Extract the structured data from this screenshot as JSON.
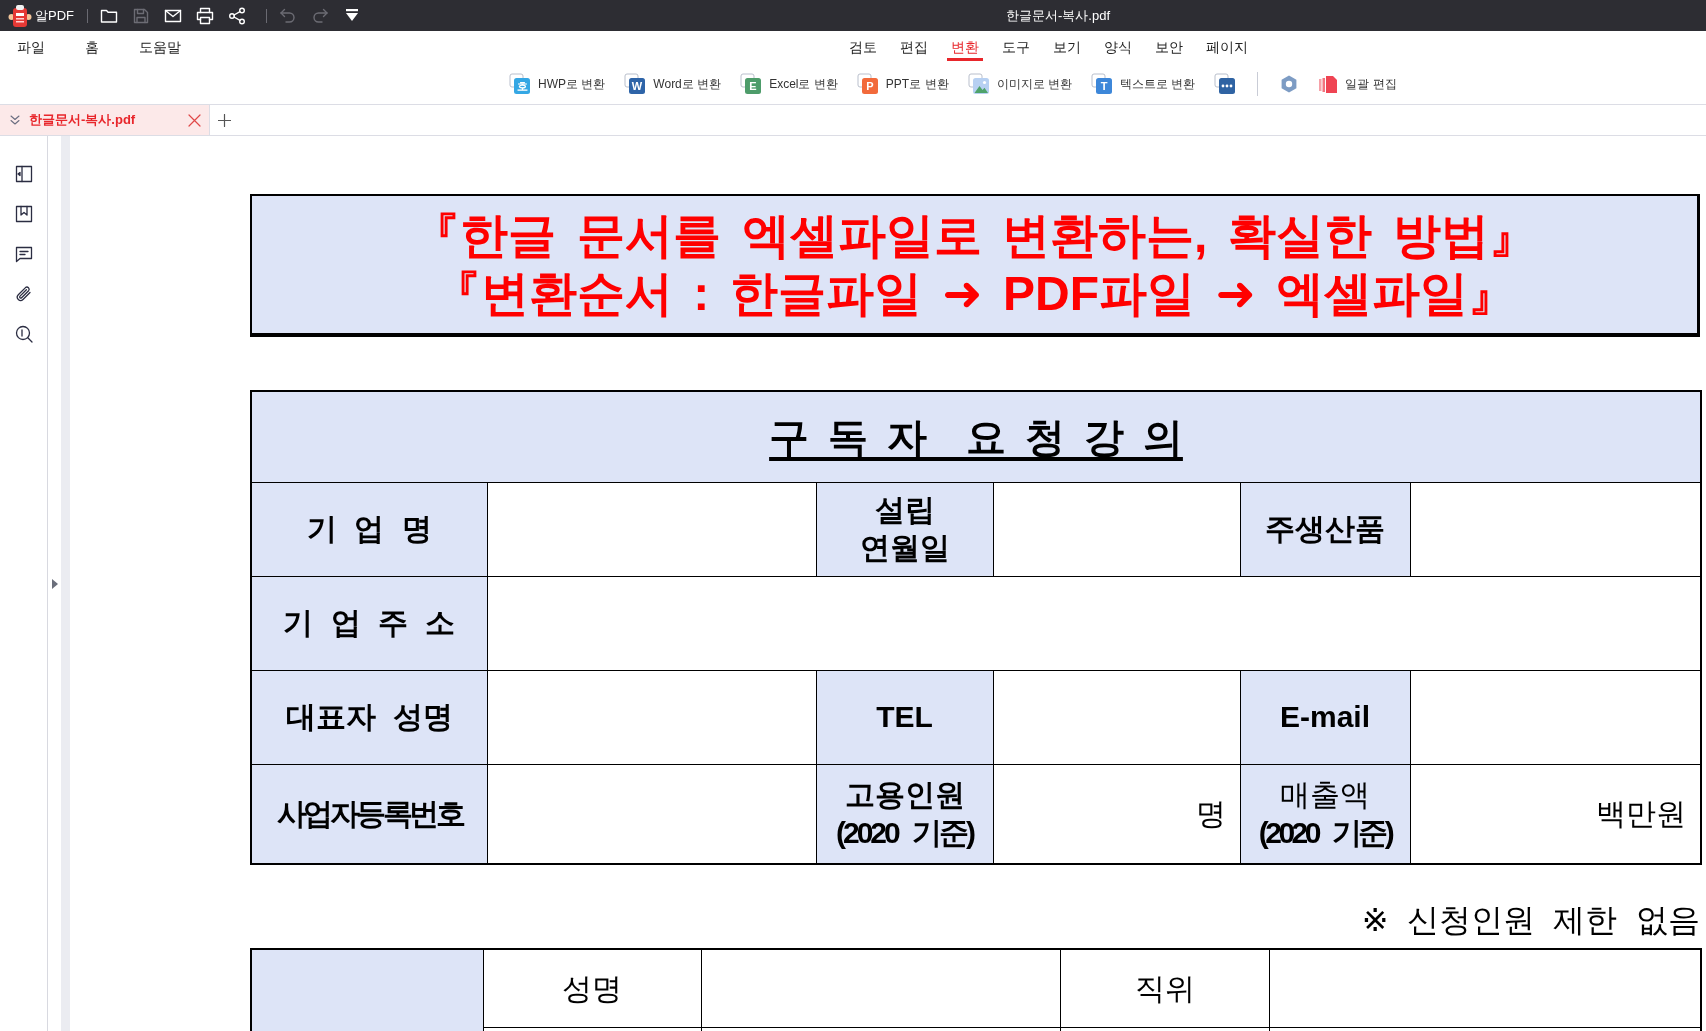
{
  "app": {
    "name": "알PDF"
  },
  "quick_access": [
    [
      {
        "kind": "folder",
        "disabled": false
      },
      {
        "kind": "save",
        "disabled": true
      },
      {
        "kind": "mail",
        "disabled": false
      },
      {
        "kind": "print",
        "disabled": false
      },
      {
        "kind": "share",
        "disabled": false
      }
    ],
    [
      {
        "kind": "undo",
        "disabled": true
      },
      {
        "kind": "redo",
        "disabled": true
      },
      {
        "kind": "customize",
        "disabled": false
      }
    ]
  ],
  "window": {
    "title": "한글문서-복사.pdf"
  },
  "menu": [
    "파일",
    "홈",
    "도움말"
  ],
  "ribbon_tabs": [
    {
      "label": "검토",
      "selected": false
    },
    {
      "label": "편집",
      "selected": false
    },
    {
      "label": "변환",
      "selected": true
    },
    {
      "label": "도구",
      "selected": false
    },
    {
      "label": "보기",
      "selected": false
    },
    {
      "label": "양식",
      "selected": false
    },
    {
      "label": "보안",
      "selected": false
    },
    {
      "label": "페이지",
      "selected": false
    }
  ],
  "ribbon_tools": [
    {
      "kind": "hwp",
      "glyph": "호",
      "label": "HWP로 변환"
    },
    {
      "kind": "word",
      "glyph": "W",
      "label": "Word로 변환"
    },
    {
      "kind": "excel",
      "glyph": "E",
      "label": "Excel로 변환"
    },
    {
      "kind": "ppt",
      "glyph": "P",
      "label": "PPT로 변환"
    },
    {
      "kind": "image",
      "label": "이미지로 변환"
    },
    {
      "kind": "text",
      "glyph": "T",
      "label": "텍스트로 변환"
    },
    {
      "kind": "more"
    }
  ],
  "ribbon_extra": [
    {
      "kind": "settings"
    },
    {
      "kind": "batch",
      "label": "일괄 편집"
    }
  ],
  "document_tabs": [
    {
      "label": "한글문서-복사.pdf",
      "selected": true
    }
  ],
  "sidebar": [
    {
      "kind": "panel"
    },
    {
      "kind": "bookmark"
    },
    {
      "kind": "comment"
    },
    {
      "kind": "attachment"
    },
    {
      "kind": "search"
    }
  ],
  "document": {
    "banner": [
      "『한글 문서를 엑셀파일로 변환하는, 확실한 방법』",
      "『변환순서 : 한글파일 ➜ PDF파일 ➜ 엑셀파일』"
    ],
    "form_table": {
      "title": "구 독 자  요 청 강 의",
      "rows": [
        [
          {
            "kind": "label",
            "lines": [
              {
                "text": "기 업 명",
                "bold": true
              }
            ]
          },
          {
            "kind": "value"
          },
          {
            "kind": "label",
            "lines": [
              {
                "text": "설립",
                "bold": true
              },
              {
                "text": "연월일",
                "bold": true
              }
            ]
          },
          {
            "kind": "value"
          },
          {
            "kind": "label",
            "lines": [
              {
                "text": "주생산품",
                "bold": true
              }
            ]
          },
          {
            "kind": "value"
          }
        ],
        [
          {
            "kind": "label",
            "lines": [
              {
                "text": "기 업 주 소",
                "bold": true
              }
            ]
          },
          {
            "kind": "value"
          }
        ],
        [
          {
            "kind": "label",
            "lines": [
              {
                "text": "대표자 성명",
                "bold": true
              }
            ]
          },
          {
            "kind": "value"
          },
          {
            "kind": "label",
            "lines": [
              {
                "text": "TEL",
                "bold": true
              }
            ]
          },
          {
            "kind": "value"
          },
          {
            "kind": "label",
            "lines": [
              {
                "text": "E-mail",
                "bold": true
              }
            ]
          },
          {
            "kind": "value"
          }
        ],
        [
          {
            "kind": "label",
            "lines": [
              {
                "text": "사업자등록번호",
                "bold": true
              }
            ]
          },
          {
            "kind": "value"
          },
          {
            "kind": "label",
            "lines": [
              {
                "text": "고용인원",
                "bold": true
              },
              {
                "text": "(2020 기준)",
                "bold": true
              }
            ]
          },
          {
            "kind": "value",
            "text": "명"
          },
          {
            "kind": "label",
            "lines": [
              {
                "text": "매출액",
                "bold": false
              },
              {
                "text": "(2020 기준)",
                "bold": true
              }
            ]
          },
          {
            "kind": "value",
            "text": "백만원"
          }
        ]
      ]
    },
    "note": "※ 신청인원 제한 없음",
    "applicant_table": {
      "rows": [
        [
          "성명",
          null,
          "직위",
          null
        ],
        [
          null,
          null,
          null,
          null
        ]
      ]
    }
  }
}
